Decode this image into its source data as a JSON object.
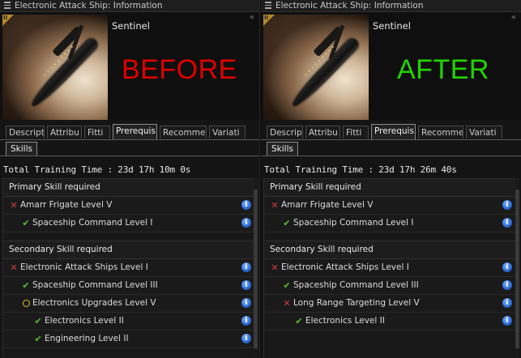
{
  "panels": {
    "left": {
      "window_title": "Electronic Attack Ship: Information",
      "ship_name": "Sentinel",
      "tech_badge": "II",
      "overlay": {
        "text": "BEFORE",
        "color": "#e00000"
      },
      "tabs": [
        "Descript",
        "Attribu",
        "Fitti",
        "Prerequis",
        "Recommen",
        "Variati"
      ],
      "subtab": "Skills",
      "total_training": "Total Training Time : 23d 17h 10m 0s",
      "primary_header": "Primary Skill required",
      "primary": [
        {
          "label": "Amarr Frigate Level V",
          "status": "x"
        },
        {
          "label": "Spaceship Command Level I",
          "status": "check"
        }
      ],
      "secondary_header": "Secondary Skill required",
      "secondary": [
        {
          "label": "Electronic Attack Ships Level I",
          "status": "x"
        },
        {
          "label": "Spaceship Command Level III",
          "status": "check"
        },
        {
          "label": "Electronics Upgrades Level V",
          "status": "partial"
        },
        {
          "label": "Electronics Level II",
          "status": "check"
        },
        {
          "label": "Engineering Level II",
          "status": "check"
        }
      ]
    },
    "right": {
      "window_title": "Electronic Attack Ship: Information",
      "ship_name": "Sentinel",
      "tech_badge": "II",
      "overlay": {
        "text": "AFTER",
        "color": "#22d400"
      },
      "tabs": [
        "Descrip",
        "Attribu",
        "Fitti",
        "Prerequis",
        "Recomme",
        "Variati"
      ],
      "subtab": "Skills",
      "total_training": "Total Training Time : 23d 17h 26m 40s",
      "primary_header": "Primary Skill required",
      "primary": [
        {
          "label": "Amarr Frigate Level V",
          "status": "x"
        },
        {
          "label": "Spaceship Command Level I",
          "status": "check"
        }
      ],
      "secondary_header": "Secondary Skill required",
      "secondary": [
        {
          "label": "Electronic Attack Ships Level I",
          "status": "x"
        },
        {
          "label": "Spaceship Command Level III",
          "status": "check"
        },
        {
          "label": "Long Range Targeting Level V",
          "status": "x"
        },
        {
          "label": "Electronics Level II",
          "status": "check"
        }
      ]
    }
  },
  "icons": {
    "menu": "hamburger-icon",
    "collapse": "double-chevron-icon",
    "info": "info-icon",
    "x": "cross-icon",
    "check": "checkmark-icon",
    "partial": "circle-icon"
  }
}
